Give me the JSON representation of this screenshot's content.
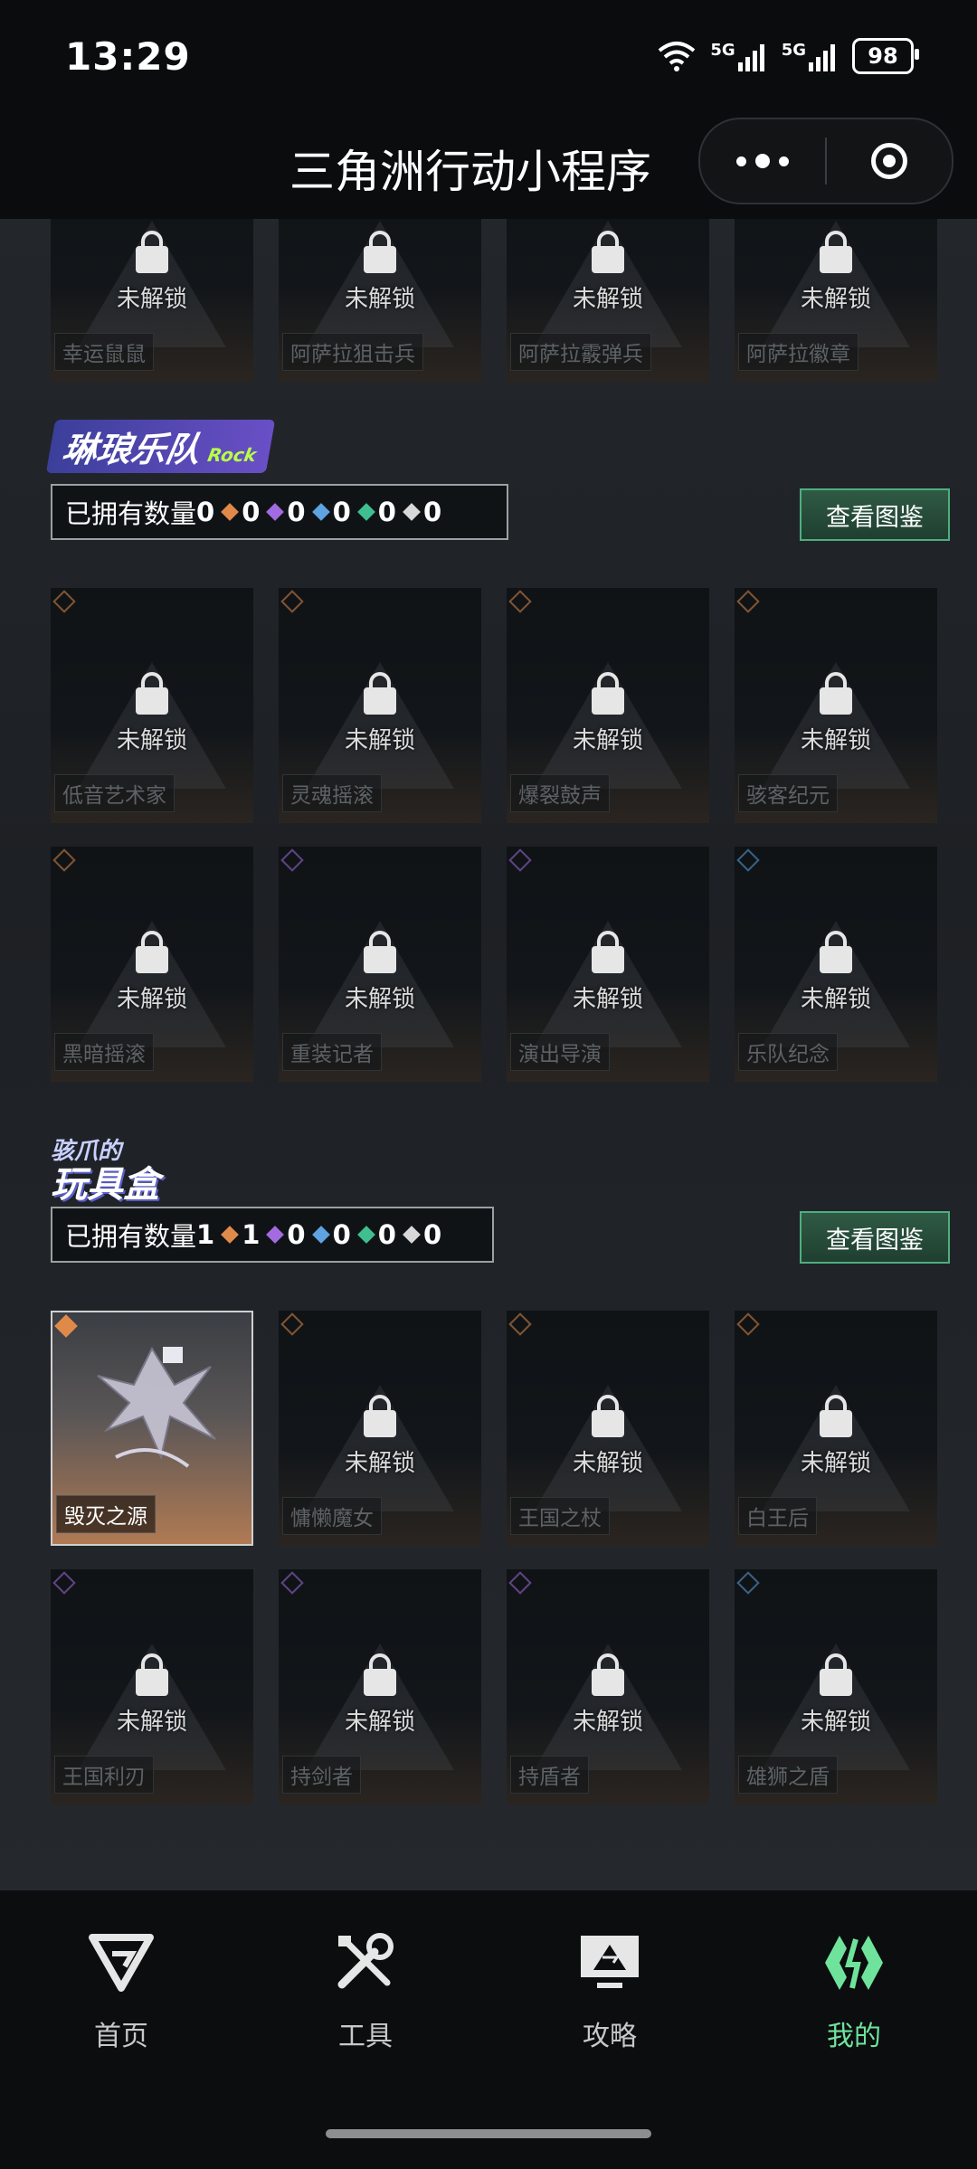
{
  "status": {
    "time": "13:29",
    "signal1": "5G",
    "signal2": "5G",
    "battery": "98"
  },
  "app": {
    "title": "三角洲行动小程序"
  },
  "top_row": [
    {
      "name": "幸运鼠鼠",
      "state": "未解锁"
    },
    {
      "name": "阿萨拉狙击兵",
      "state": "未解锁"
    },
    {
      "name": "阿萨拉霰弹兵",
      "state": "未解锁"
    },
    {
      "name": "阿萨拉徽章",
      "state": "未解锁"
    }
  ],
  "band_section": {
    "logo": "琳琅乐队",
    "logo_sub": "Rock",
    "owned_label": "已拥有数量",
    "owned_count": "0",
    "gems": [
      "0",
      "0",
      "0",
      "0",
      "0"
    ],
    "button": "查看图鉴",
    "items": [
      {
        "name": "低音艺术家",
        "state": "未解锁"
      },
      {
        "name": "灵魂摇滚",
        "state": "未解锁"
      },
      {
        "name": "爆裂鼓声",
        "state": "未解锁"
      },
      {
        "name": "骇客纪元",
        "state": "未解锁"
      },
      {
        "name": "黑暗摇滚",
        "state": "未解锁"
      },
      {
        "name": "重装记者",
        "state": "未解锁"
      },
      {
        "name": "演出导演",
        "state": "未解锁"
      },
      {
        "name": "乐队纪念",
        "state": "未解锁"
      }
    ]
  },
  "toy_section": {
    "logo_line1": "骇爪的",
    "logo_line2": "玩具盒",
    "owned_label": "已拥有数量",
    "owned_count": "1",
    "gems": [
      "1",
      "0",
      "0",
      "0",
      "0"
    ],
    "button": "查看图鉴",
    "items": [
      {
        "name": "毁灭之源",
        "state": ""
      },
      {
        "name": "慵懒魔女",
        "state": "未解锁"
      },
      {
        "name": "王国之杖",
        "state": "未解锁"
      },
      {
        "name": "白王后",
        "state": "未解锁"
      },
      {
        "name": "王国利刃",
        "state": "未解锁"
      },
      {
        "name": "持剑者",
        "state": "未解锁"
      },
      {
        "name": "持盾者",
        "state": "未解锁"
      },
      {
        "name": "雄狮之盾",
        "state": "未解锁"
      }
    ]
  },
  "colors": {
    "accent": "#6fe39c",
    "orange": "#e08a4a",
    "purple": "#a36be0",
    "blue": "#5fa3e0",
    "green": "#3fbf8f",
    "white": "#d8d8d8"
  },
  "tabs": [
    {
      "label": "首页",
      "icon": "home-logo-icon"
    },
    {
      "label": "工具",
      "icon": "tools-icon"
    },
    {
      "label": "攻略",
      "icon": "guide-monitor-icon"
    },
    {
      "label": "我的",
      "icon": "profile-logo-icon"
    }
  ]
}
